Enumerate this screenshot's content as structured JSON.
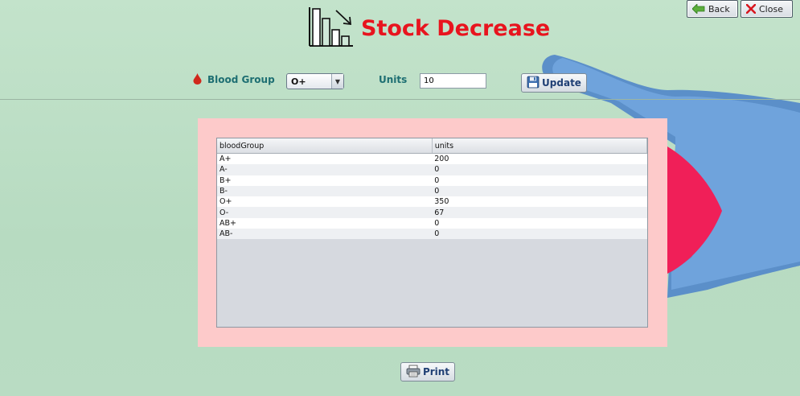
{
  "window": {
    "title": "Stock Decrease",
    "back_label": "Back",
    "close_label": "Close"
  },
  "form": {
    "blood_group_label": "Blood Group",
    "blood_group_value": "O+",
    "units_label": "Units",
    "units_value": "10",
    "update_label": "Update"
  },
  "table": {
    "columns": [
      "bloodGroup",
      "units"
    ],
    "rows": [
      [
        "A+",
        "200"
      ],
      [
        "A-",
        "0"
      ],
      [
        "B+",
        "0"
      ],
      [
        "B-",
        "0"
      ],
      [
        "O+",
        "350"
      ],
      [
        "O-",
        "67"
      ],
      [
        "AB+",
        "0"
      ],
      [
        "AB-",
        "0"
      ]
    ]
  },
  "footer": {
    "print_label": "Print"
  },
  "colors": {
    "title": "#e8141e",
    "label": "#1d6e72",
    "panel": "#fdcaca",
    "background": "#b9dcc2"
  },
  "icons": [
    "chart-decrease-icon",
    "back-arrow-icon",
    "close-x-icon",
    "blood-drop-icon",
    "save-icon",
    "printer-icon"
  ]
}
